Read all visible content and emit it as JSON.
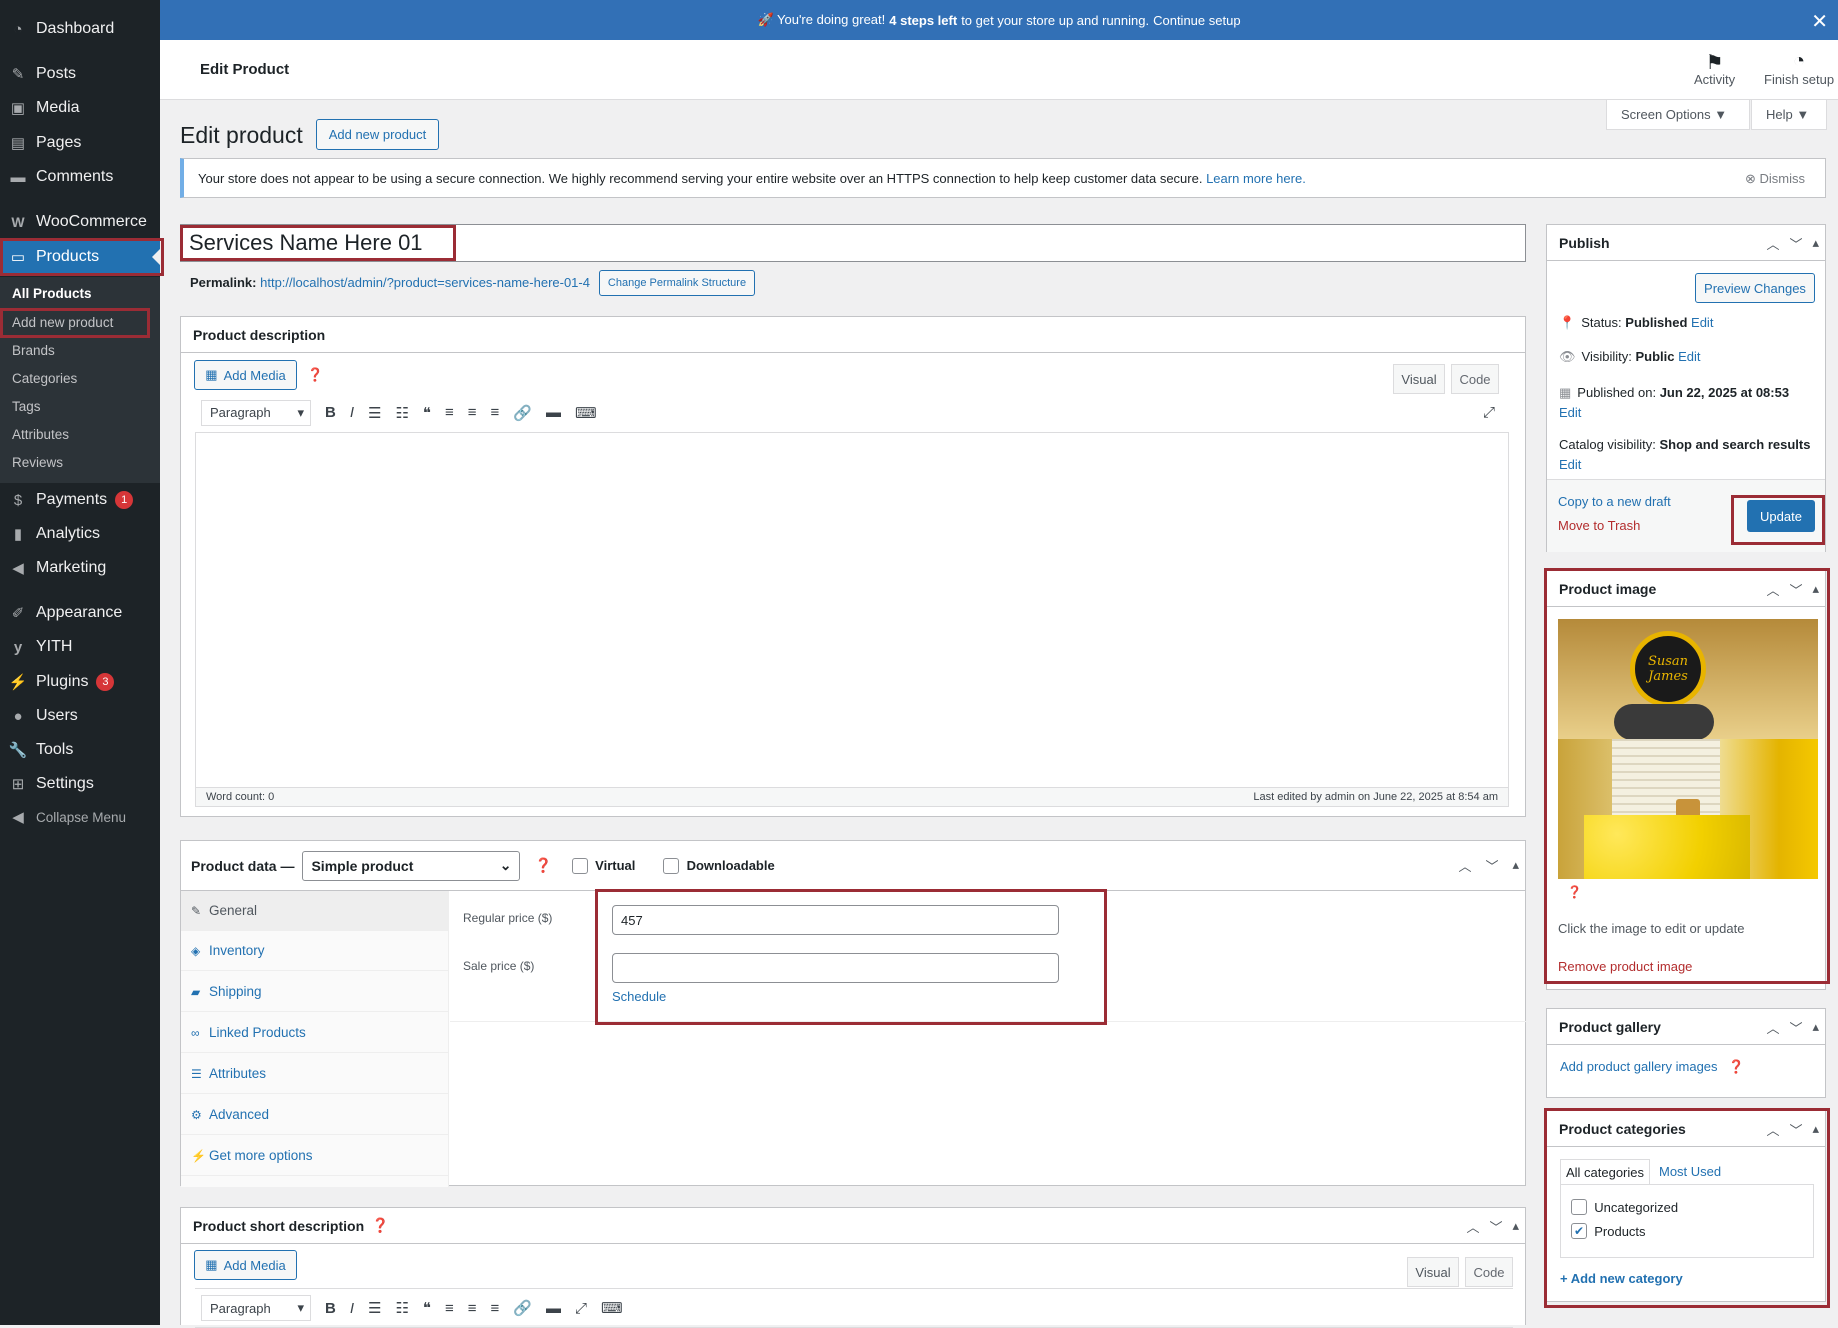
{
  "banner": {
    "prefix": "🚀 You're doing great!",
    "bold": "4 steps left",
    "middle": "to get your store up and running.",
    "link": "Continue setup"
  },
  "header": {
    "title": "Edit Product",
    "activity": "Activity",
    "finish": "Finish setup"
  },
  "screen_options": {
    "screen": "Screen Options ▼",
    "help": "Help ▼"
  },
  "page": {
    "title": "Edit product",
    "add_new": "Add new product"
  },
  "notice": {
    "text": "Your store does not appear to be using a secure connection. We highly recommend serving your entire website over an HTTPS connection to help keep customer data secure.",
    "link": "Learn more here.",
    "dismiss": "Dismiss"
  },
  "sidebar": {
    "dashboard": "Dashboard",
    "posts": "Posts",
    "media": "Media",
    "pages": "Pages",
    "comments": "Comments",
    "woocommerce": "WooCommerce",
    "products": "Products",
    "sub": [
      "All Products",
      "Add new product",
      "Brands",
      "Categories",
      "Tags",
      "Attributes",
      "Reviews"
    ],
    "payments": "Payments",
    "payments_badge": "1",
    "analytics": "Analytics",
    "marketing": "Marketing",
    "appearance": "Appearance",
    "yith": "YITH",
    "plugins": "Plugins",
    "plugins_badge": "3",
    "users": "Users",
    "tools": "Tools",
    "settings": "Settings",
    "collapse": "Collapse Menu"
  },
  "product": {
    "title": "Services Name Here 01",
    "permalink_label": "Permalink:",
    "permalink_url": "http://localhost/admin/?product=services-name-here-01-4",
    "permalink_btn": "Change Permalink Structure"
  },
  "description": {
    "heading": "Product description",
    "add_media": "Add Media",
    "visual": "Visual",
    "code": "Code",
    "format": "Paragraph",
    "word_count": "Word count: 0",
    "last_edited": "Last edited by admin on June 22, 2025 at 8:54 am"
  },
  "product_data": {
    "heading": "Product data —",
    "type": "Simple product",
    "virtual": "Virtual",
    "downloadable": "Downloadable",
    "tabs": [
      "General",
      "Inventory",
      "Shipping",
      "Linked Products",
      "Attributes",
      "Advanced",
      "Get more options"
    ],
    "regular_label": "Regular price ($)",
    "regular_value": "457",
    "sale_label": "Sale price ($)",
    "sale_value": "",
    "schedule": "Schedule"
  },
  "short_description": {
    "heading": "Product short description",
    "add_media": "Add Media",
    "visual": "Visual",
    "code": "Code",
    "format": "Paragraph"
  },
  "publish": {
    "heading": "Publish",
    "preview": "Preview Changes",
    "status_label": "Status:",
    "status": "Published",
    "visibility_label": "Visibility:",
    "visibility": "Public",
    "published_label": "Published on:",
    "published": "Jun 22, 2025 at 08:53",
    "catalog_label": "Catalog visibility:",
    "catalog": "Shop and search results",
    "edit": "Edit",
    "copy": "Copy to a new draft",
    "trash": "Move to Trash",
    "update": "Update"
  },
  "product_image": {
    "heading": "Product image",
    "hint": "Click the image to edit or update",
    "remove": "Remove product image",
    "cake_text": "Susan James"
  },
  "gallery": {
    "heading": "Product gallery",
    "add": "Add product gallery images"
  },
  "categories": {
    "heading": "Product categories",
    "tab_all": "All categories",
    "tab_used": "Most Used",
    "items": [
      {
        "label": "Uncategorized",
        "checked": false
      },
      {
        "label": "Products",
        "checked": true
      }
    ],
    "add": "+ Add new category"
  },
  "colors": {
    "accent": "#2271b1",
    "sidebar": "#1d2327",
    "highlight": "#9b2c35",
    "banner": "#3270b6"
  }
}
